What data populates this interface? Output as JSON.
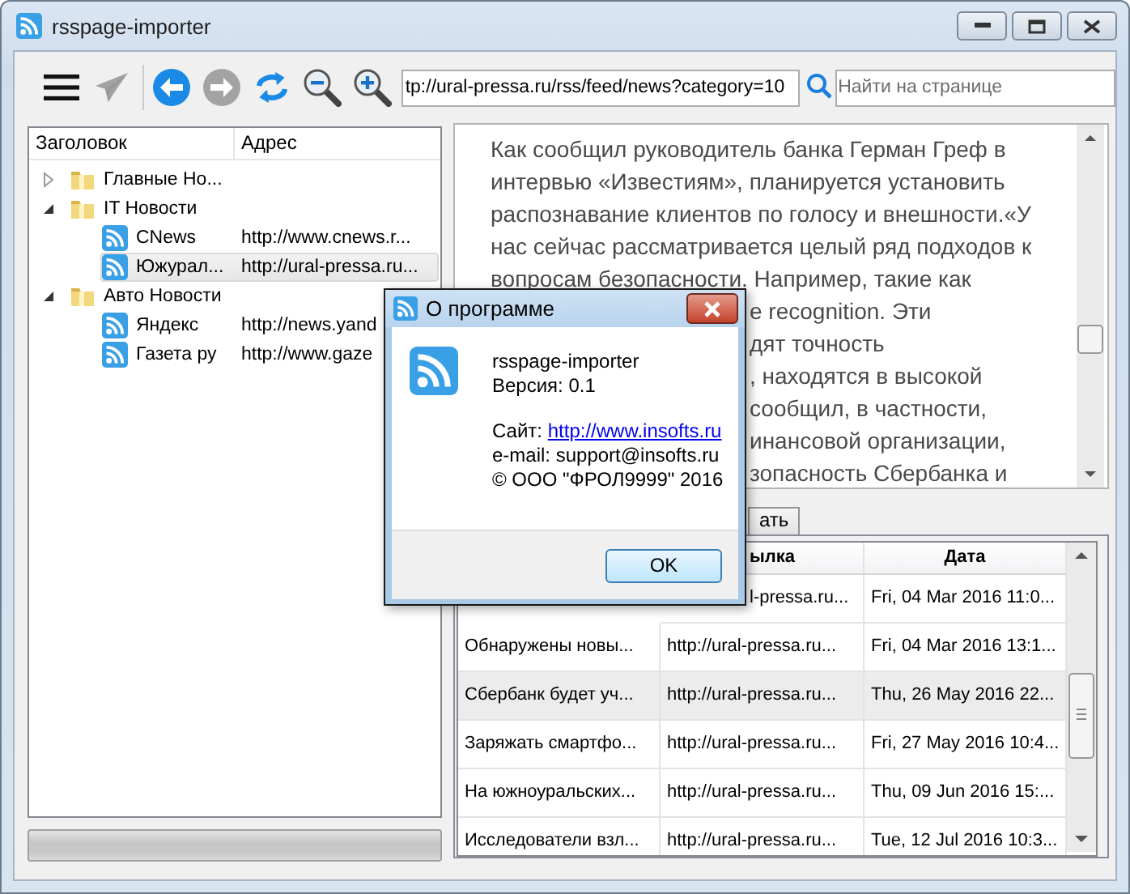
{
  "window": {
    "title": "rsspage-importer"
  },
  "toolbar": {
    "buttons": [
      {
        "kind": "menu",
        "disabled": false
      },
      {
        "kind": "send",
        "disabled": true
      },
      {
        "kind": "separator"
      },
      {
        "kind": "back",
        "disabled": false
      },
      {
        "kind": "forward",
        "disabled": true
      },
      {
        "kind": "refresh",
        "disabled": false
      },
      {
        "kind": "zoom-out",
        "disabled": false
      },
      {
        "kind": "zoom-in",
        "disabled": false
      }
    ],
    "address": {
      "value": "tp://ural-pressa.ru/rss/feed/news?category=10"
    },
    "search": {
      "placeholder": "Найти на странице"
    }
  },
  "tree": {
    "columns": [
      "Заголовок",
      "Адрес"
    ],
    "items": [
      {
        "kind": "folder",
        "title": "Главные Но...",
        "expanded": false,
        "selected": false
      },
      {
        "kind": "folder",
        "title": "IT Новости",
        "expanded": true,
        "selected": false,
        "children": [
          {
            "kind": "feed",
            "title": "CNews",
            "address": "http://www.cnews.r...",
            "selected": false
          },
          {
            "kind": "feed",
            "title": "Южурал...",
            "address": "http://ural-pressa.ru...",
            "selected": true
          }
        ]
      },
      {
        "kind": "folder",
        "title": "Авто Новости",
        "expanded": true,
        "selected": false,
        "children": [
          {
            "kind": "feed",
            "title": "Яндекс",
            "address": "http://news.yand",
            "selected": false
          },
          {
            "kind": "feed",
            "title": "Газета ру",
            "address": "http://www.gaze",
            "selected": false
          }
        ]
      }
    ]
  },
  "article": {
    "lines": [
      {
        "text": "Как сообщил руководитель банка Герман Греф в",
        "clipped": false
      },
      {
        "text": "интервью «Известиям», планируется установить",
        "clipped": false
      },
      {
        "text": "распознавание клиентов по голосу и внешности.«У",
        "clipped": false
      },
      {
        "text": "нас сейчас рассматривается целый ряд подходов к",
        "clipped": false
      },
      {
        "text": "вопросам безопасности. Например, такие как",
        "clipped": false
      },
      {
        "text": "e recognition. Эти",
        "clipped": true
      },
      {
        "text": "дят точность",
        "clipped": true
      },
      {
        "text": ", находятся в высокой",
        "clipped": true
      },
      {
        "text": "сообщил, в частности,",
        "clipped": true
      },
      {
        "text": "инансовой организации,",
        "clipped": true
      },
      {
        "text": "зопасность Сбербанка и",
        "clipped": true
      }
    ]
  },
  "tabs": [
    {
      "label": "ать",
      "selected": false
    }
  ],
  "table": {
    "columns": [
      {
        "label": "ылка",
        "clipped": true
      },
      {
        "label": "Дата",
        "clipped": false
      }
    ],
    "rows": [
      {
        "link": "l-pressa.ru...",
        "link_clipped": true,
        "date": "Fri, 04 Mar 2016 11:0...",
        "selected": false
      },
      {
        "title": "Обнаружены новы...",
        "link": "http://ural-pressa.ru...",
        "link_clipped": false,
        "date": "Fri, 04 Mar 2016 13:1...",
        "selected": false
      },
      {
        "title": "Сбербанк будет уч...",
        "link": "http://ural-pressa.ru...",
        "link_clipped": false,
        "date": "Thu, 26 May 2016 22...",
        "selected": true
      },
      {
        "title": "Заряжать смартфо...",
        "link": "http://ural-pressa.ru...",
        "link_clipped": false,
        "date": "Fri, 27 May 2016 10:4...",
        "selected": false
      },
      {
        "title": "На южноуральских...",
        "link": "http://ural-pressa.ru...",
        "link_clipped": false,
        "date": "Thu, 09 Jun 2016 15:...",
        "selected": false
      },
      {
        "title": "Исследователи взл...",
        "link": "http://ural-pressa.ru...",
        "link_clipped": false,
        "date": "Tue, 12 Jul 2016 10:3...",
        "selected": false
      }
    ]
  },
  "dialog": {
    "title": "О программе",
    "app_name": "rsspage-importer",
    "version": "Версия: 0.1",
    "site": {
      "label": "Сайт:",
      "link": "http://www.insofts.ru"
    },
    "email": "e-mail: support@insofts.ru",
    "copyright": "© ООО \"ФРОЛ9999\" 2016",
    "button": "OK"
  }
}
